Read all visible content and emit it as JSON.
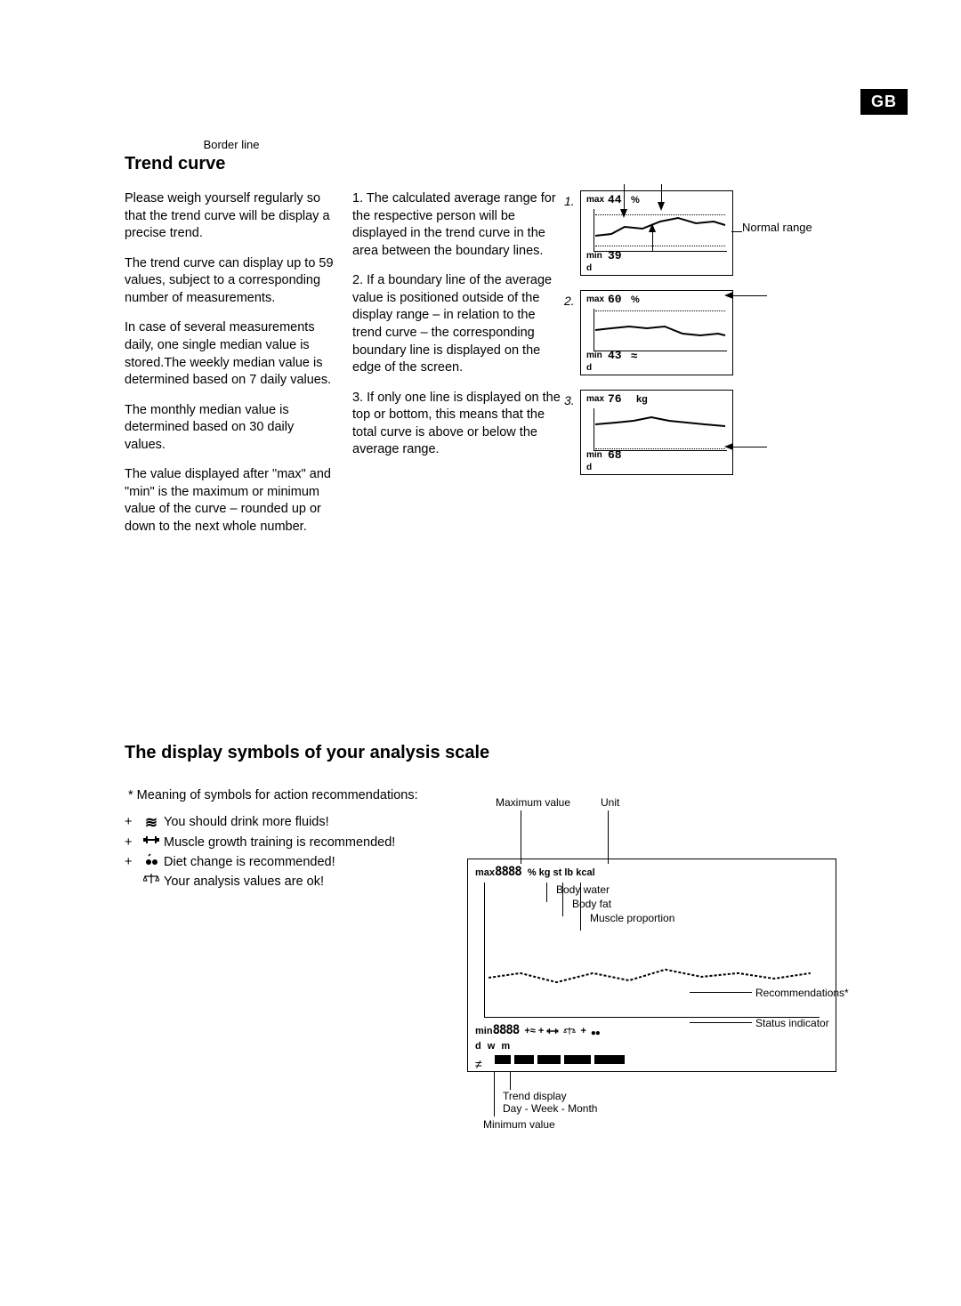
{
  "lang_badge": "GB",
  "section1": {
    "heading": "Trend curve",
    "left_paras": [
      "Please weigh yourself regularly so that the trend curve will be display a precise trend.",
      "The trend curve can display up to 59 values, subject to a corre­sponding number of measure­ments.",
      "In case of several measurements daily, one single median value is stored.The weekly median value is determined based on 7 daily values.",
      "The monthly median value is determined based on 30 daily values.",
      "The value displayed after \"max\" and \"min\" is the maximum or minimum value of the curve – rounded up or down to the next whole number."
    ],
    "mid_paras": [
      "1. The calculated average range for the respective person will be displayed in the trend curve in the area between the boundary lines.",
      "2. If a boundary line of the ave­rage value is positioned outsi­de of the display range – in relation to the trend curve – the corresponding boundary line is displayed on the edge of the screen.",
      "3. If only one line is displayed on the top or bottom, this means that the total curve is above or below the average range."
    ],
    "fig_border_line_label": "Border line",
    "fig_normal_range_label": "Normal range",
    "figs": [
      {
        "n": "1.",
        "max": "44",
        "min": "39",
        "unit": "%",
        "period": "d",
        "show_top_dash": true,
        "show_bot_dash": true
      },
      {
        "n": "2.",
        "max": "60",
        "min": "43",
        "unit": "%",
        "period": "d",
        "show_top_dash": true,
        "show_bot_dash": false,
        "icon_bot": "water"
      },
      {
        "n": "3.",
        "max": "76",
        "min": "68",
        "unit": "kg",
        "period": "d",
        "show_top_dash": false,
        "show_bot_dash": true
      }
    ]
  },
  "section2": {
    "heading": "The display symbols of your analysis scale",
    "intro": "* Meaning of symbols for action recommendations:",
    "symbols": [
      {
        "plus": "+",
        "icon": "water",
        "text": "You should drink more fluids!"
      },
      {
        "plus": "+",
        "icon": "muscle",
        "text": "Muscle growth training is recommended!"
      },
      {
        "plus": "+",
        "icon": "diet",
        "text": "Diet change is recommended!"
      },
      {
        "plus": "",
        "icon": "scale",
        "text": "Your analysis values are ok!"
      }
    ],
    "diagram": {
      "labels": {
        "max_value": "Maximum value",
        "unit": "Unit",
        "body_water": "Body water",
        "body_fat": "Body fat",
        "muscle": "Muscle proportion",
        "recommendations": "Recommendations*",
        "status_indicator": "Status indicator",
        "trend_display": "Trend display",
        "trend_sub": "Day - Week - Month",
        "min_value": "Minimum value"
      },
      "top_row": {
        "max": "max",
        "digits": "8888",
        "units": "% kg st lb kcal"
      },
      "bot_row": {
        "min": "min",
        "digits": "8888",
        "period": "d w m"
      }
    }
  }
}
